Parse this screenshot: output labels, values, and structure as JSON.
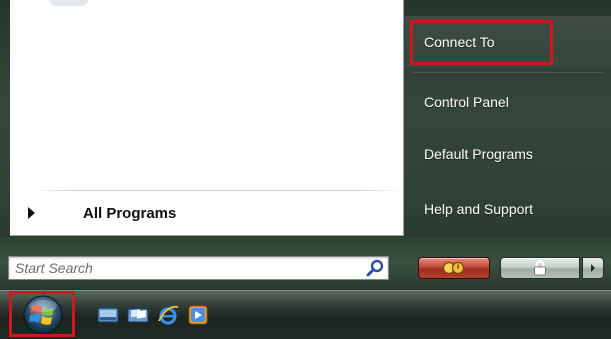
{
  "left_pane": {
    "all_programs_label": "All Programs"
  },
  "search": {
    "placeholder": "Start Search",
    "icon": "magnifier-icon"
  },
  "right_pane": {
    "items": [
      {
        "label": "Connect To",
        "highlighted": true
      },
      {
        "label": "Control Panel"
      },
      {
        "label": "Default Programs"
      },
      {
        "label": "Help and Support"
      }
    ]
  },
  "power_controls": {
    "buttons": [
      "power-button",
      "lock-button",
      "options-arrow-button"
    ],
    "power_color": "#b3422f"
  },
  "taskbar": {
    "start_button_highlighted": true,
    "quick_launch_icons": [
      "show-desktop-icon",
      "switch-windows-icon",
      "internet-explorer-icon",
      "media-player-icon"
    ]
  },
  "colors": {
    "menu_background": "#2f4134",
    "highlight": "#d4141f",
    "text_on_dark": "#ffffff"
  }
}
